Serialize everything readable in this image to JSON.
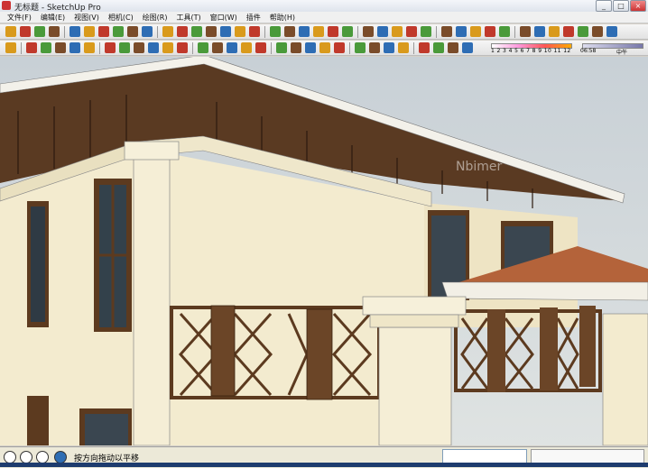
{
  "window": {
    "title": "无标题 - SketchUp Pro",
    "buttons": [
      "_",
      "□",
      "×"
    ]
  },
  "menu": [
    {
      "label": "文件(F)"
    },
    {
      "label": "编辑(E)"
    },
    {
      "label": "视图(V)"
    },
    {
      "label": "相机(C)"
    },
    {
      "label": "绘图(R)"
    },
    {
      "label": "工具(T)"
    },
    {
      "label": "窗口(W)"
    },
    {
      "label": "插件"
    },
    {
      "label": "帮助(H)"
    }
  ],
  "colors": {
    "toolbar_a": "#c0392b",
    "toolbar_b": "#2e6db4",
    "toolbar_c": "#4a9a3a",
    "toolbar_d": "#d99a1c",
    "toolbar_e": "#7a4c2a"
  },
  "shadow": {
    "ticks": "1 2 3 4 5 6 7 8 9 10 11 12",
    "time_start": "06:58",
    "time_noon": "中午"
  },
  "viewport": {
    "watermark": "Nbimer"
  },
  "status": {
    "hint": "按方向拖动以平移"
  }
}
